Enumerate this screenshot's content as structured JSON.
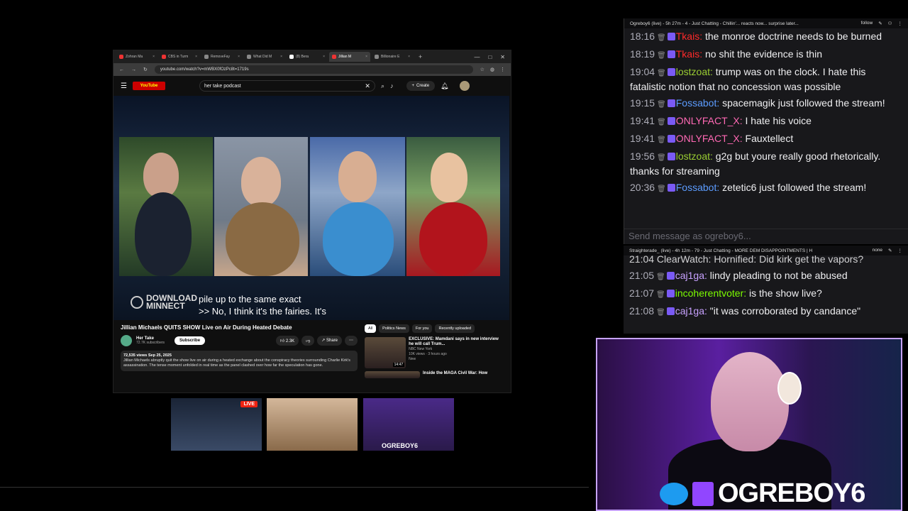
{
  "browser": {
    "tabs": [
      {
        "label": "Zohran Ma",
        "fav": "youtube"
      },
      {
        "label": "CBS in Turm",
        "fav": "youtube"
      },
      {
        "label": "RemoveFay",
        "fav": "web"
      },
      {
        "label": "What Did M",
        "fav": "web"
      },
      {
        "label": "(8) Bera",
        "fav": "x"
      },
      {
        "label": "Jillian M",
        "fav": "youtube",
        "active": true
      },
      {
        "label": "Billionaire E",
        "fav": "web"
      }
    ],
    "url": "youtube.com/watch?v=mWBX0fOzPc8t=1719s"
  },
  "youtube": {
    "logo_text": "YouTube",
    "search_value": "her take podcast",
    "create_label": "Create",
    "watermark": [
      "DOWNLOAD",
      "MINNECT"
    ],
    "caption_lines": [
      "pile up to the same exact",
      ">> No, I think it's the fairies. It's"
    ],
    "video_title": "Jillian Michaels QUITS SHOW Live on Air During Heated Debate",
    "channel_name": "Her Take",
    "channel_subs": "72.7K subscribers",
    "subscribe_label": "Subscribe",
    "likes": "2.3K",
    "share_label": "Share",
    "views_date": "72,535 views  Sep 25, 2025",
    "description": "Jillian Michaels abruptly quit the show live on air during a heated exchange about the conspiracy theories surrounding Charlie Kirk's assassination. The tense moment unfolded in real time as the panel clashed over how far the speculation has gone.",
    "chips": [
      "All",
      "Politics News",
      "For you",
      "Recently uploaded"
    ],
    "rec": [
      {
        "title": "EXCLUSIVE: Mamdani says in new interview he will call Trum...",
        "channel": "NBC New York",
        "meta": "10K views · 3 hours ago",
        "badge": "New",
        "duration": "14:47"
      },
      {
        "title": "Inside the MAGA Civil War: How",
        "channel": "",
        "meta": "",
        "badge": "",
        "duration": ""
      }
    ]
  },
  "strip": {
    "live_label": "LIVE",
    "name_label": "OGREBOY6"
  },
  "chat1": {
    "header": "Ogreboy6 (live) - 5h 27m - 4 - Just Chatting - Chillin'... reacts now... surprise later...",
    "follow_label": "follow",
    "messages": [
      {
        "time": "18:16",
        "user": "Tkais",
        "color": "#ff2a2a",
        "text": "the monroe doctrine needs to be burned"
      },
      {
        "time": "18:19",
        "user": "Tkais",
        "color": "#ff2a2a",
        "text": "no shit the evidence is thin"
      },
      {
        "time": "19:04",
        "user": "lostzoat",
        "color": "#9acd32",
        "text": "trump was on the clock. I hate this fatalistic notion that no concession was possible"
      },
      {
        "time": "19:15",
        "user": "Fossabot",
        "color": "#5c9cff",
        "text": "spacemagik just followed the stream!"
      },
      {
        "time": "19:41",
        "user": "ONLYFACT_X",
        "color": "#ff69b4",
        "text": "I hate his voice"
      },
      {
        "time": "19:41",
        "user": "ONLYFACT_X",
        "color": "#ff69b4",
        "text": "Fauxtellect"
      },
      {
        "time": "19:56",
        "user": "lostzoat",
        "color": "#9acd32",
        "text": "g2g but youre really good rhetorically. thanks for streaming"
      },
      {
        "time": "20:36",
        "user": "Fossabot",
        "color": "#5c9cff",
        "text": "zetetic6 just followed the stream!"
      }
    ],
    "input_placeholder": "Send message as ogreboy6..."
  },
  "chat2": {
    "header": "Straighterade_ (live) - 4h 12m - 79 - Just Chatting - MORE DEM DISAPPOINTMENTS | H",
    "none_label": "none",
    "partial": "21:04   ClearWatch: Hornified: Did kirk get the vapors?",
    "messages": [
      {
        "time": "21:05",
        "user": "caj1ga",
        "color": "#c8a2ff",
        "text": "lindy pleading to not be abused"
      },
      {
        "time": "21:07",
        "user": "incoherentvoter",
        "color": "#7cfc00",
        "text": "is the show live?"
      },
      {
        "time": "21:08",
        "user": "caj1ga",
        "color": "#c8a2ff",
        "text": "\"it was corroborated by candance\""
      }
    ]
  },
  "cam": {
    "brand": "OGREBOY6"
  }
}
